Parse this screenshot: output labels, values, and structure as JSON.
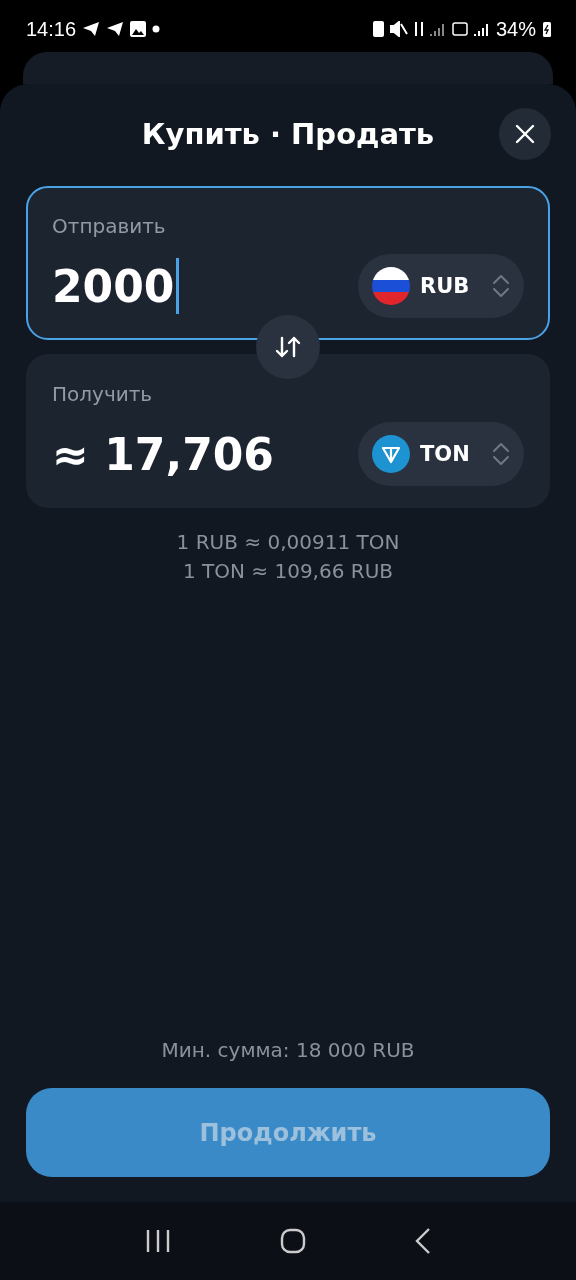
{
  "status_bar": {
    "time": "14:16",
    "battery": "34%"
  },
  "title": "Купить · Продать",
  "send": {
    "label": "Отправить",
    "value": "2000",
    "focused": true,
    "currency": {
      "code": "RUB",
      "kind": "flag"
    }
  },
  "receive": {
    "label": "Получить",
    "value": "≈ 17,706",
    "focused": false,
    "currency": {
      "code": "TON",
      "kind": "ton"
    }
  },
  "rates": [
    "1 RUB ≈ 0,00911 TON",
    "1 TON ≈ 109,66 RUB"
  ],
  "min_amount": "Мин. сумма: 18 000 RUB",
  "continue_button": {
    "label": "Продолжить",
    "disabled": true
  }
}
